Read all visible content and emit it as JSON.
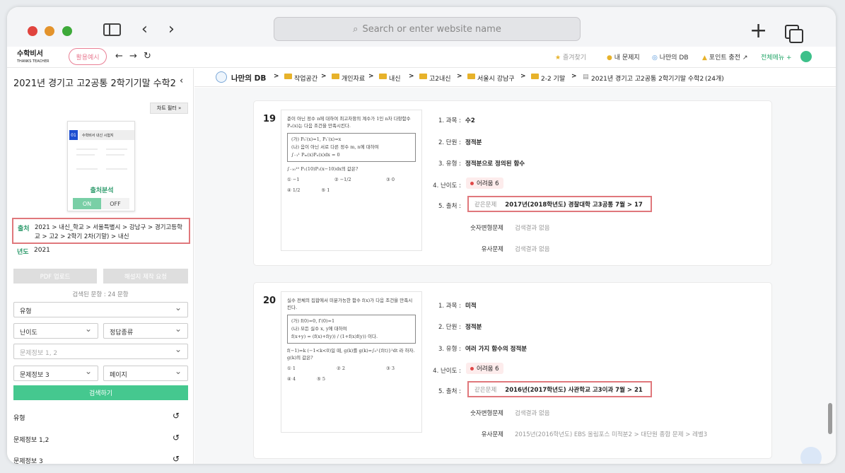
{
  "browser": {
    "address_placeholder": "Search or enter website name"
  },
  "app": {
    "logo": "수학비서",
    "logo_sub": "THANKS TEACHER",
    "usage_label": "활용예시",
    "nav": {
      "favorites": "즐겨찾기",
      "my_problems": "내 문제지",
      "my_db": "나만의 DB",
      "points": "포인트 충전",
      "all_menu": "전체메뉴"
    }
  },
  "sidebar": {
    "title": "2021년 경기고 고2공통 2학기기말 수학2",
    "chart_filter": "차트 필터 »",
    "thumb": {
      "num": "01",
      "header": "수학비서 내신 시험지",
      "label": "출처분석",
      "on": "ON",
      "off": "OFF"
    },
    "source_label": "출처",
    "source_value": "2021 > 내신_학교 > 서울특별시 > 강남구 > 경기고등학교 > 고2 > 2학기 2차(기말) > 내신",
    "year_label": "년도",
    "year_value": "2021",
    "pdf_btn": "PDF 업로드",
    "explain_btn": "해설지 제작 요청",
    "count": "검색된 문항 : 24 문항",
    "filters": {
      "type": "유형",
      "difficulty": "난이도",
      "answer_type": "정답종류",
      "info12_placeholder": "문제정보 1, 2",
      "info3": "문제정보 3",
      "page": "페이지"
    },
    "search_btn": "검색하기",
    "facets": [
      "유형",
      "문제정보 1,2",
      "문제정보 3"
    ]
  },
  "breadcrumb": {
    "db_title": "나만의 DB",
    "items": [
      "작업공간",
      "개인자료",
      "내신",
      "고2내신",
      "서울시 강남구",
      "2-2 기말"
    ],
    "current": "2021년 경기고 고2공통 2학기기말 수학2",
    "count": "(24개)"
  },
  "questions": [
    {
      "num": "19",
      "stem": "준이 아닌 정수 n에 대하여 최고차항의 계수가 1인 n차 다항함수 Pₙ(x)는 다음 조건을 만족시킨다.",
      "cond1": "(가) P₀′(x)=1,  P₁′(x)=x",
      "cond2": "(나) 음이 아닌 서로 다른 정수 m, n에 대하여",
      "cond3": "∫₋₁¹ Pₘ(x)Pₙ(x)dx = 0",
      "ask": "∫₋₁₀¹⁰ P₁(10)P₁(x−10)dx의 값은?",
      "opts": [
        "① −1",
        "② −1/2",
        "③ 0",
        "④ 1/2",
        "⑤ 1"
      ],
      "labels": [
        "1. 과목 :",
        "2. 단원 :",
        "3. 유형 :",
        "4. 난이도 :",
        "5. 출처 :"
      ],
      "subject": "수2",
      "unit": "정적분",
      "type": "정적분으로 정의된 함수",
      "difficulty": "어려움 6",
      "same_label": "같은문제",
      "same_value": "2017년(2018학년도) 경찰대학 고3공통 7월 > 17",
      "num_var_label": "숫자변형문제",
      "num_var_value": "검색결과 없음",
      "similar_label": "유사문제",
      "similar_value": "검색결과 없음"
    },
    {
      "num": "20",
      "stem": "실수 전체의 집합에서 미분가능한 함수 f(x)가 다음 조건을 만족시킨다.",
      "cond1": "(가) f(0)=0,  f′(0)=1",
      "cond2": "(나) 모든 실수 x, y에 대하여",
      "cond3": "f(x+y) = (f(x)+f(y)) / (1+f(x)f(y)) 이다.",
      "ask": "f(−1)=k (−1<k<0)일 때, g(k)를 g(k)=∫₀¹{f(t)}²dt 라 하자. g(k)의 값은?",
      "opts": [
        "① 1",
        "② 2",
        "③ 3",
        "④ 4",
        "⑤ 5"
      ],
      "labels": [
        "1. 과목 :",
        "2. 단원 :",
        "3. 유형 :",
        "4. 난이도 :",
        "5. 출처 :"
      ],
      "subject": "미적",
      "unit": "정적분",
      "type": "여러 가지 함수의 정적분",
      "difficulty": "어려움 6",
      "same_label": "같은문제",
      "same_value": "2016년(2017학년도) 사관학교 고3이과 7월 > 21",
      "num_var_label": "숫자변형문제",
      "num_var_value": "검색결과 없음",
      "similar_label": "유사문제",
      "similar_value": "2015년(2016학년도) EBS 올림포스 미적분2 > 대단원 종합 문제 > 레벨3"
    }
  ],
  "colors": {
    "accent": "#45c88f",
    "highlight": "#e0787c",
    "green_text": "#2e9b6c"
  }
}
